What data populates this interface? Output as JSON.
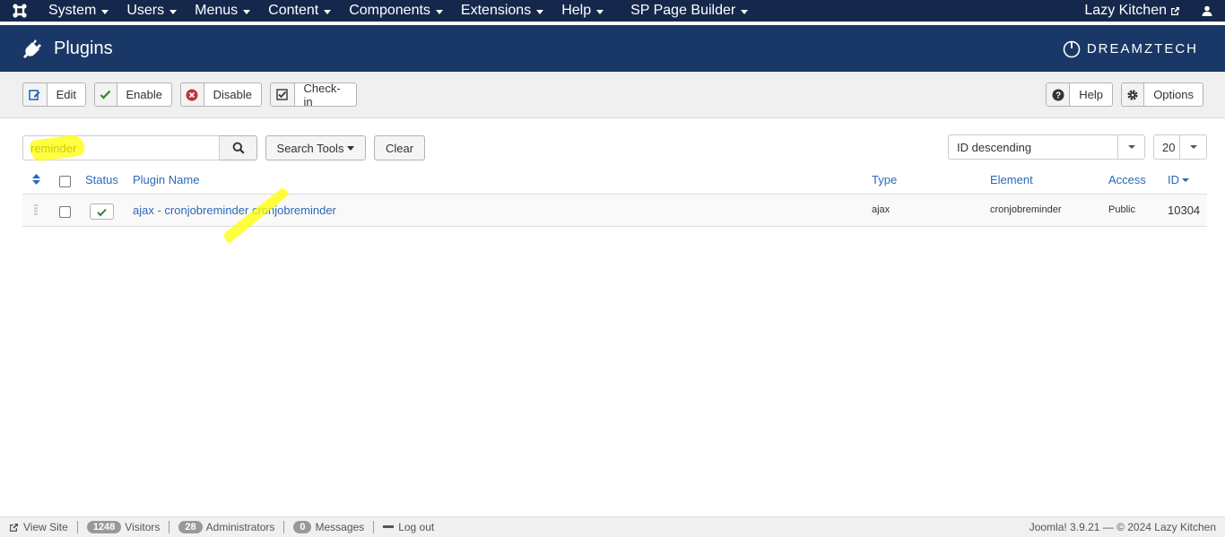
{
  "nav": {
    "menu": [
      {
        "label": "System"
      },
      {
        "label": "Users"
      },
      {
        "label": "Menus"
      },
      {
        "label": "Content"
      },
      {
        "label": "Components"
      },
      {
        "label": "Extensions"
      },
      {
        "label": "Help"
      }
    ],
    "sp_page_builder": "SP Page Builder",
    "site_name": "Lazy Kitchen"
  },
  "header": {
    "title": "Plugins",
    "brand": "DREAMZTECH"
  },
  "toolbar": {
    "edit": "Edit",
    "enable": "Enable",
    "disable": "Disable",
    "checkin": "Check-in",
    "help": "Help",
    "options": "Options"
  },
  "filters": {
    "search_value": "reminder",
    "search_tools": "Search Tools",
    "clear": "Clear",
    "ordering": "ID descending",
    "limit": "20"
  },
  "table": {
    "headers": {
      "status": "Status",
      "plugin_name": "Plugin Name",
      "type": "Type",
      "element": "Element",
      "access": "Access",
      "id": "ID"
    },
    "rows": [
      {
        "name": "ajax - cronjobreminder cronjobreminder",
        "type": "ajax",
        "element": "cronjobreminder",
        "access": "Public",
        "id": "10304",
        "enabled": true
      }
    ]
  },
  "footer": {
    "view_site": "View Site",
    "visitors_count": "1248",
    "visitors_label": "Visitors",
    "admins_count": "28",
    "admins_label": "Administrators",
    "messages_count": "0",
    "messages_label": "Messages",
    "logout": "Log out",
    "version": "Joomla! 3.9.21 — © 2024 Lazy Kitchen"
  },
  "colors": {
    "navbar": "#15284b",
    "header": "#1a3867",
    "link": "#2a69b8",
    "highlight": "#ffff00"
  }
}
